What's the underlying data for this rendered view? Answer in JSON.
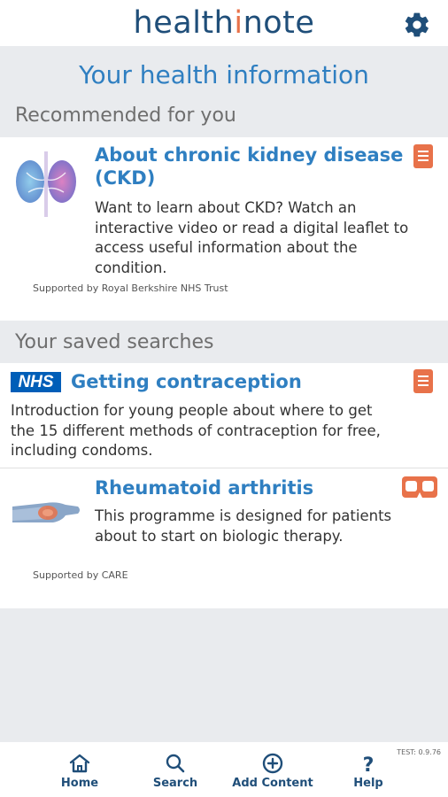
{
  "header": {
    "logo_prefix": "health",
    "logo_accent": "i",
    "logo_suffix": "note",
    "settings_icon": "gear-icon"
  },
  "page": {
    "title": "Your health information"
  },
  "recommended": {
    "heading": "Recommended for you",
    "items": [
      {
        "title_line1": "About chronic kidney disease",
        "title_line2": "(CKD)",
        "description_lines": [
          "Want to learn about CKD? Watch an",
          "interactive video or read a digital leaflet to",
          "access useful information about the",
          "condition."
        ],
        "supported_by": "Supported by Royal Berkshire NHS Trust",
        "image": "kidney-illustration",
        "type_icon": "document-icon"
      }
    ]
  },
  "saved": {
    "heading": "Your saved searches",
    "items": [
      {
        "badge": "NHS",
        "title": "Getting contraception",
        "description_lines": [
          "Introduction for young people about where to get",
          "the 15 different methods of contraception for free,",
          "including condoms."
        ],
        "type_icon": "document-icon"
      },
      {
        "title": "Rheumatoid arthritis",
        "description_lines": [
          "This programme is designed for patients",
          "about to start on biologic therapy."
        ],
        "supported_by": "Supported by CARE",
        "image": "hand-wrist-illustration",
        "type_icon": "vr-headset-icon"
      }
    ]
  },
  "footer": {
    "version": "TEST: 0.9.76",
    "nav": [
      {
        "label": "Home",
        "icon": "home-icon"
      },
      {
        "label": "Search",
        "icon": "search-icon"
      },
      {
        "label": "Add Content",
        "icon": "add-circle-icon"
      },
      {
        "label": "Help",
        "icon": "help-icon"
      }
    ]
  },
  "colors": {
    "brand_blue": "#1f4e79",
    "link_blue": "#2f7fc1",
    "accent_orange": "#e8724a",
    "nhs_blue": "#005eb8",
    "background": "#e9ebee"
  }
}
